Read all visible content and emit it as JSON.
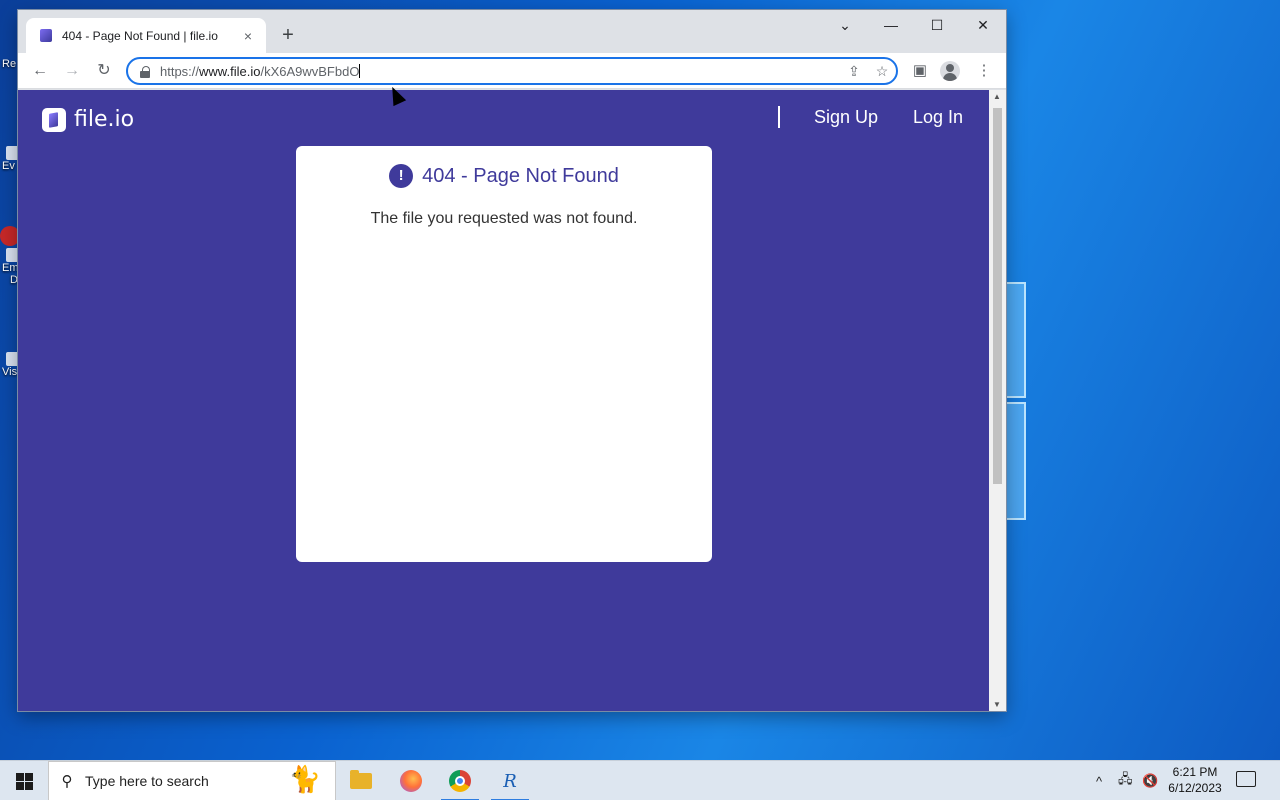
{
  "desktop": {
    "icons": [
      {
        "label": "Re"
      },
      {
        "label": "Ev"
      },
      {
        "label": "Em"
      },
      {
        "label": "D"
      },
      {
        "label": "Vis"
      }
    ]
  },
  "browser": {
    "tab": {
      "title": "404 - Page Not Found | file.io",
      "close_icon": "×"
    },
    "new_tab_icon": "+",
    "window_controls": {
      "dropdown": "⌄",
      "minimize": "—",
      "maximize": "☐",
      "close": "✕"
    },
    "toolbar": {
      "back": "←",
      "forward": "→",
      "reload": "↻",
      "url_scheme": "https://",
      "url_host": "www.file.io",
      "url_path": "/kX6A9wvBFbdO",
      "share_icon": "⇪",
      "bookmark_icon": "☆",
      "sidepanel_icon": "▣",
      "menu_icon": "⋮"
    }
  },
  "page": {
    "logo_text": "file.io",
    "nav": {
      "signup": "Sign Up",
      "login": "Log In"
    },
    "error": {
      "icon": "!",
      "title": "404 - Page Not Found",
      "message": "The file you requested was not found."
    }
  },
  "taskbar": {
    "search_placeholder": "Type here to search",
    "search_icon": "⚲",
    "cat_icon": "🐈",
    "apps": [
      {
        "name": "file-explorer"
      },
      {
        "name": "firefox"
      },
      {
        "name": "chrome",
        "active": true
      },
      {
        "name": "rapp",
        "glyph": "R"
      }
    ],
    "tray": {
      "chevron": "^",
      "network": "🖧",
      "volume": "🔇"
    },
    "clock": {
      "time": "6:21 PM",
      "date": "6/12/2023"
    }
  },
  "colors": {
    "page_bg": "#3f3a9b",
    "accent": "#1a73e8"
  }
}
